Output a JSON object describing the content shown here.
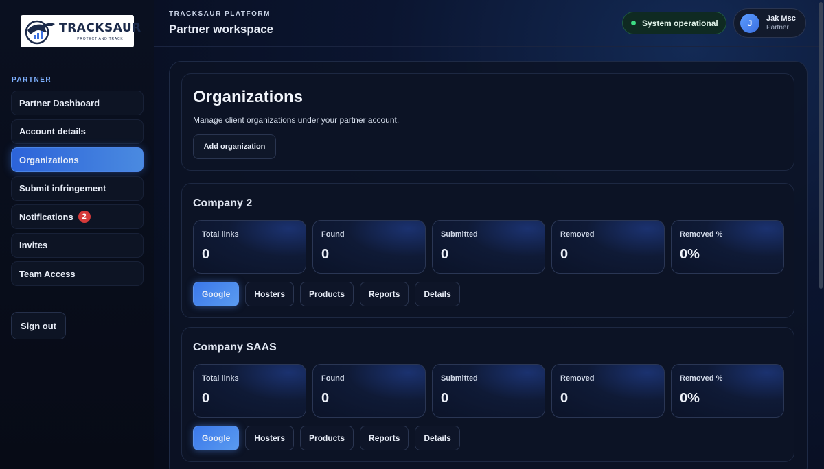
{
  "brand": {
    "name": "TRACKSAUR",
    "tagline": "PROTECT AND TRACK"
  },
  "sidebar": {
    "section_label": "PARTNER",
    "items": [
      {
        "label": "Partner Dashboard"
      },
      {
        "label": "Account details"
      },
      {
        "label": "Organizations",
        "active": true
      },
      {
        "label": "Submit infringement"
      },
      {
        "label": "Notifications",
        "badge": "2"
      },
      {
        "label": "Invites"
      },
      {
        "label": "Team Access"
      }
    ],
    "sign_out": "Sign out"
  },
  "header": {
    "eyebrow": "TRACKSAUR PLATFORM",
    "title": "Partner workspace",
    "status": "System operational",
    "user": {
      "initial": "J",
      "name": "Jak Msc",
      "role": "Partner"
    }
  },
  "page": {
    "title": "Organizations",
    "description": "Manage client organizations under your partner account.",
    "add_button": "Add organization"
  },
  "stat_labels": [
    "Total links",
    "Found",
    "Submitted",
    "Removed",
    "Removed %"
  ],
  "tab_labels": [
    "Google",
    "Hosters",
    "Products",
    "Reports",
    "Details"
  ],
  "organizations": [
    {
      "name": "Company 2",
      "stats": [
        "0",
        "0",
        "0",
        "0",
        "0%"
      ],
      "active_tab": "Google"
    },
    {
      "name": "Company SAAS",
      "stats": [
        "0",
        "0",
        "0",
        "0",
        "0%"
      ],
      "active_tab": "Google"
    }
  ],
  "colors": {
    "accent": "#3b78ea",
    "status_green": "#3ddc84",
    "badge_red": "#d63a3a"
  }
}
